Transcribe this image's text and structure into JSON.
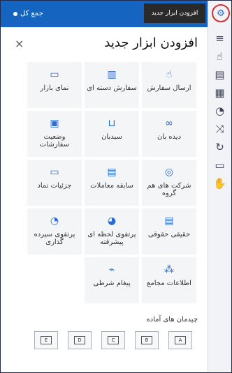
{
  "topbar": {
    "total_label": "جمع کل",
    "tooltip": "افزودن ابزار جدید"
  },
  "panel": {
    "title": "افزودن ابزار جدید",
    "close": "×"
  },
  "tiles": [
    {
      "label": "ارسال سفارش",
      "icon": "hand-pointer-icon"
    },
    {
      "label": "سفارش دسته ای",
      "icon": "batch-order-icon"
    },
    {
      "label": "نمای بازار",
      "icon": "market-view-icon"
    },
    {
      "label": "دیده بان",
      "icon": "binoculars-icon"
    },
    {
      "label": "سبدبان",
      "icon": "basket-icon"
    },
    {
      "label": "وضعیت سفارشات",
      "icon": "order-status-icon"
    },
    {
      "label": "شرکت های هم گروه",
      "icon": "group-companies-icon"
    },
    {
      "label": "سابقه معاملات",
      "icon": "trade-history-icon"
    },
    {
      "label": "جزئیات نماد",
      "icon": "symbol-details-icon"
    },
    {
      "label": "حقیقی حقوقی",
      "icon": "individual-legal-icon"
    },
    {
      "label": "پرتفوی لحظه ای پیشرفته",
      "icon": "advanced-portfolio-icon"
    },
    {
      "label": "پرتفوی سپرده گذاری",
      "icon": "deposit-portfolio-icon"
    },
    {
      "label": "اطلاعات مجامع",
      "icon": "assemblies-icon"
    },
    {
      "label": "پیغام شرطی",
      "icon": "conditional-message-icon"
    }
  ],
  "presets": {
    "label": "چیدمان های آماده",
    "items": [
      "A",
      "B",
      "C",
      "D",
      "E"
    ]
  }
}
